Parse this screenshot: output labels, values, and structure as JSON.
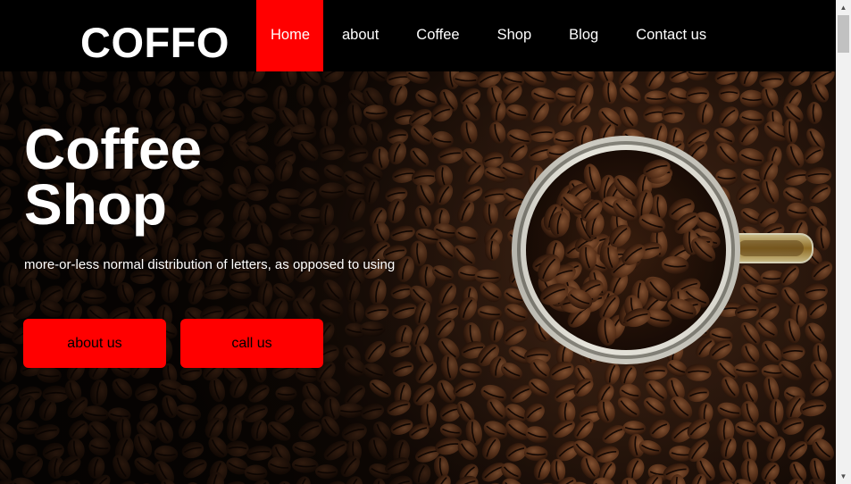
{
  "header": {
    "logo": "COFFO",
    "nav": [
      {
        "label": "Home",
        "active": true
      },
      {
        "label": "about",
        "active": false
      },
      {
        "label": "Coffee",
        "active": false
      },
      {
        "label": "Shop",
        "active": false
      },
      {
        "label": "Blog",
        "active": false
      },
      {
        "label": "Contact us",
        "active": false
      }
    ]
  },
  "hero": {
    "title_line1": "Coffee",
    "title_line2": "Shop",
    "text": "more-or-less normal distribution of letters, as opposed to using",
    "buttons": {
      "about": "about us",
      "call": "call us"
    },
    "image": "coffee-beans-cup"
  },
  "colors": {
    "accent": "#ff0000",
    "header_bg": "#000000",
    "text": "#ffffff"
  },
  "scrollbar": {
    "up_icon": "▲",
    "down_icon": "▼"
  }
}
